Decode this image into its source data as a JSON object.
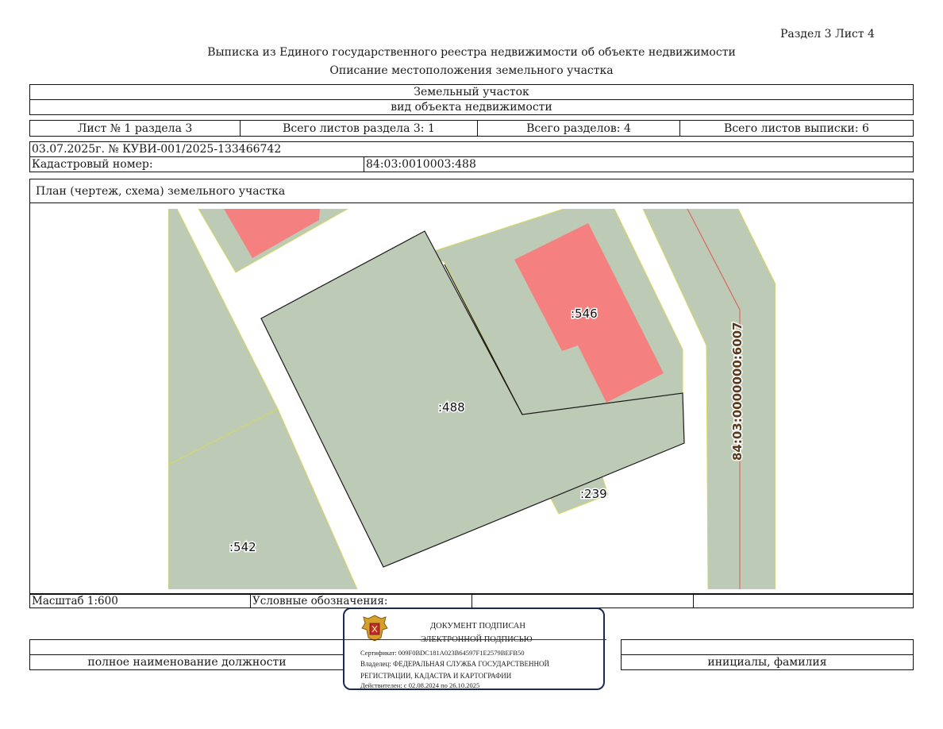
{
  "header": {
    "section_sheet": "Раздел 3    Лист 4",
    "title": "Выписка из Единого государственного реестра недвижимости об объекте недвижимости",
    "subtitle": "Описание местоположения земельного участка"
  },
  "object": {
    "type": "Земельный участок",
    "type_caption": "вид объекта недвижимости"
  },
  "sheets": {
    "sheet_of_section": "Лист № 1 раздела 3",
    "total_sheets_section": "Всего листов раздела 3: 1",
    "total_sections": "Всего разделов: 4",
    "total_sheets_extract": "Всего листов выписки: 6"
  },
  "record": {
    "date_number": "03.07.2025г. № КУВИ-001/2025-133466742",
    "cadastral_label": "Кадастровый номер:",
    "cadastral_number": "84:03:0010003:488"
  },
  "plan": {
    "title": "План (чертеж, схема) земельного участка",
    "labels": {
      "parcel_546": ":546",
      "parcel_488": ":488",
      "parcel_239": ":239",
      "parcel_542": ":542",
      "parcel_6007": "84:03:0000000:6007"
    },
    "colors": {
      "parcel_fill": "#bccab6",
      "building_fill": "#f48080",
      "boundary_line": "#e0584d"
    }
  },
  "footer": {
    "scale": "Масштаб 1:600",
    "legend_label": "Условные обозначения:",
    "position_caption": "полное наименование должности",
    "name_caption": "инициалы, фамилия"
  },
  "stamp": {
    "emblem": "emblem-icon",
    "line1": "ДОКУМЕНТ ПОДПИСАН",
    "line2": "ЭЛЕКТРОННОЙ ПОДПИСЬЮ",
    "certificate": "Сертификат: 009F0BDC181A023B64597F1E2579BEFB50",
    "owner_line1": "Владелец: ФЕДЕРАЛЬНАЯ СЛУЖБА ГОСУДАРСТВЕННОЙ",
    "owner_line2": "РЕГИСТРАЦИИ, КАДАСТРА И КАРТОГРАФИИ",
    "valid": "Действителен: с 02.08.2024 по 26.10.2025",
    "border_color": "#1b2a55"
  }
}
